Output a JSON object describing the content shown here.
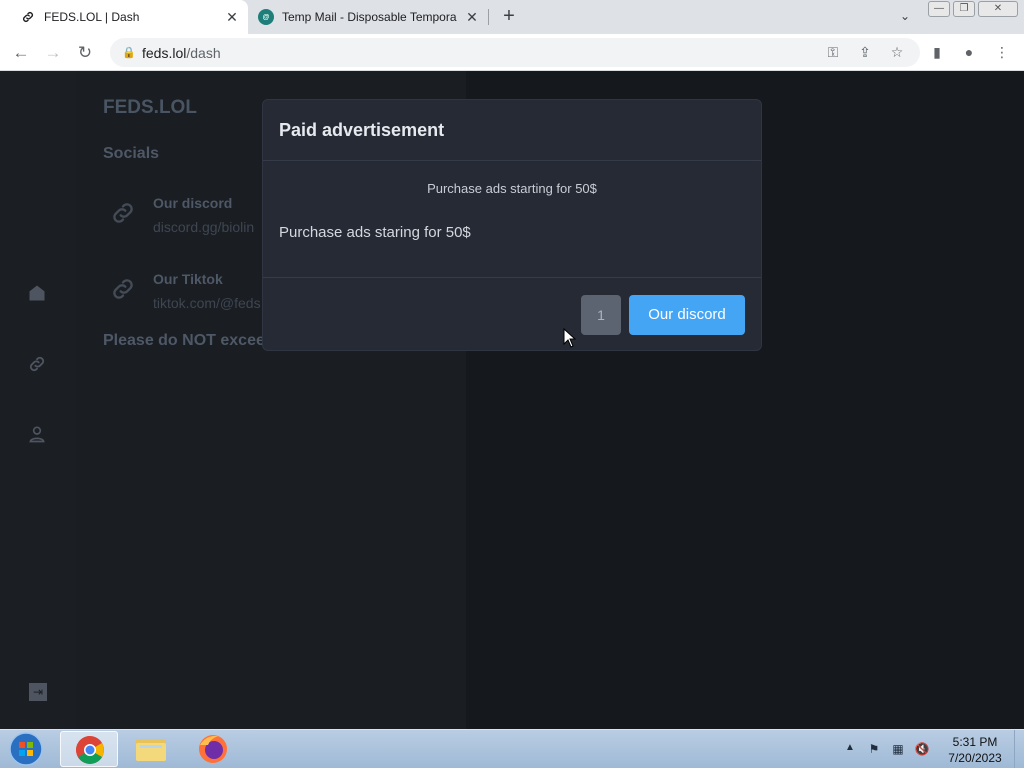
{
  "browser": {
    "tabs": [
      {
        "title": "FEDS.LOL | Dash",
        "active": true,
        "favicon": "link-icon"
      },
      {
        "title": "Temp Mail - Disposable Tempora",
        "active": false,
        "favicon": "temp-mail-icon"
      }
    ],
    "url_host": "feds.lol",
    "url_path": "/dash"
  },
  "sidebar": {
    "brand": "FEDS.LOL",
    "section_title": "Socials",
    "socials": [
      {
        "title": "Our discord",
        "url": "discord.gg/biolin"
      },
      {
        "title": "Our Tiktok",
        "url": "tiktok.com/@feds"
      }
    ],
    "notice": "Please do NOT excee"
  },
  "modal": {
    "title": "Paid advertisement",
    "subtitle": "Purchase ads starting for 50$",
    "body": "Purchase ads staring for 50$",
    "count_button": "1",
    "action_button": "Our discord"
  },
  "taskbar": {
    "time": "5:31 PM",
    "date": "7/20/2023"
  },
  "colors": {
    "accent": "#45a5f5",
    "modal_bg": "#252a35",
    "page_bg": "#15181d"
  }
}
